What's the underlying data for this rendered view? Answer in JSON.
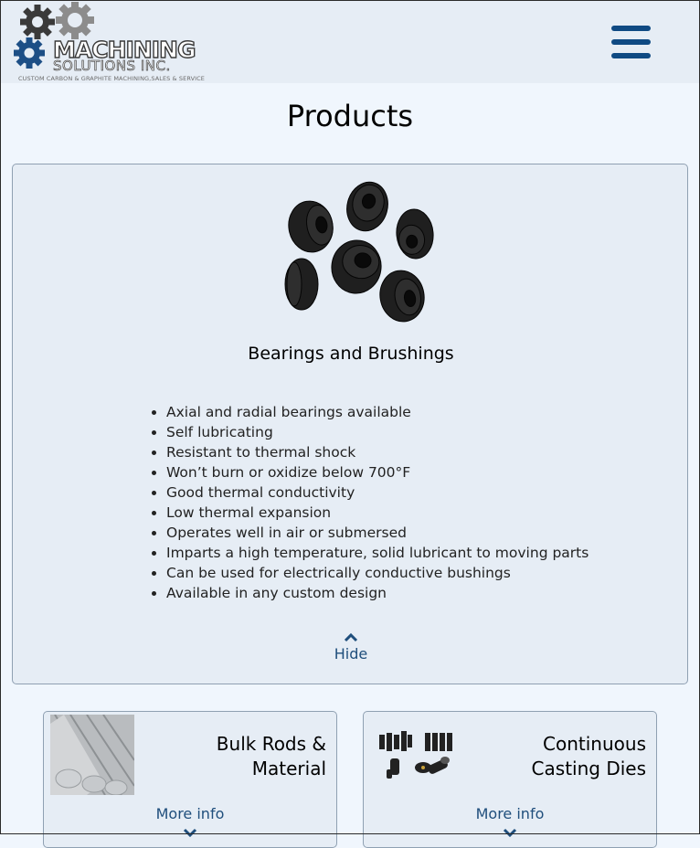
{
  "brand": {
    "name": "MACHINING",
    "sub": "SOLUTIONS INC.",
    "tagline": "CUSTOM CARBON & GRAPHITE MACHINING,SALES & SERVICE",
    "colors": {
      "accent": "#0f4a83",
      "gear_dark": "#3a3a3a",
      "gear_light": "#8c8c8c",
      "gear_blue": "#1d4f86"
    }
  },
  "header": {
    "menu_icon": "hamburger-icon"
  },
  "page": {
    "title": "Products"
  },
  "expanded_product": {
    "title": "Bearings and Brushings",
    "image_icon": "graphite-bushings-photo",
    "features": [
      "Axial and radial bearings available",
      "Self lubricating",
      "Resistant to thermal shock",
      "Won’t burn or oxidize below 700°F",
      "Good thermal conductivity",
      "Low thermal expansion",
      "Operates well in air or submersed",
      "Imparts a high temperature, solid lubricant to moving parts",
      "Can be used for electrically conductive bushings",
      "Available in any custom design"
    ],
    "toggle_label": "Hide"
  },
  "products": [
    {
      "name_line1": "Bulk Rods &",
      "name_line2": "Material",
      "more_label": "More info",
      "image_icon": "graphite-rods-photo"
    },
    {
      "name_line1": "Continuous",
      "name_line2": "Casting Dies",
      "more_label": "More info",
      "image_icon": "casting-dies-photo"
    }
  ]
}
